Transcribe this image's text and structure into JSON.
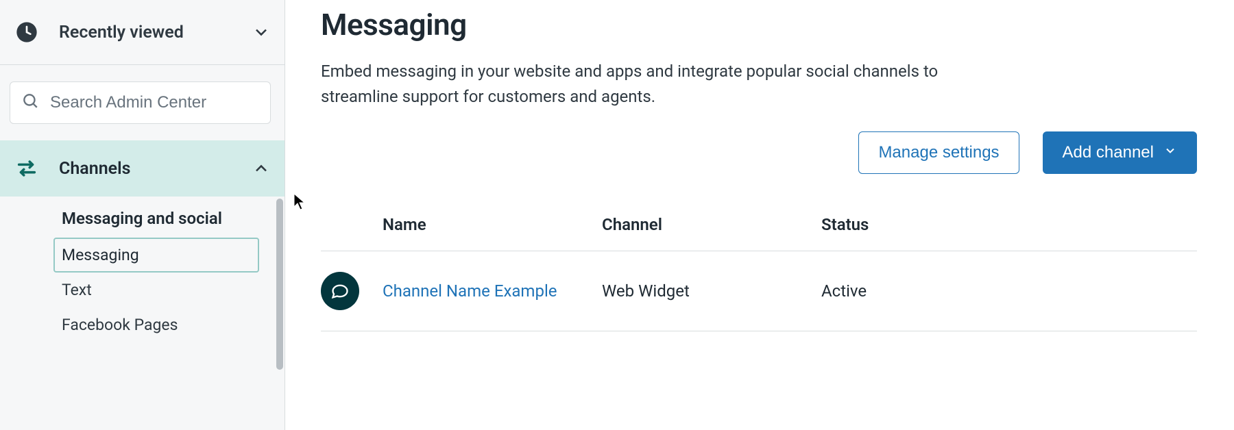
{
  "sidebar": {
    "recently_viewed": "Recently viewed",
    "search_placeholder": "Search Admin Center",
    "channels": "Channels",
    "group_title": "Messaging and social",
    "items": [
      {
        "label": "Messaging",
        "active": true
      },
      {
        "label": "Text",
        "active": false
      },
      {
        "label": "Facebook Pages",
        "active": false
      }
    ]
  },
  "page": {
    "title": "Messaging",
    "description": "Embed messaging in your website and apps and integrate popular social channels to streamline support for customers and agents."
  },
  "actions": {
    "manage": "Manage settings",
    "add_channel": "Add channel"
  },
  "table": {
    "headers": {
      "name": "Name",
      "channel": "Channel",
      "status": "Status"
    },
    "rows": [
      {
        "name": "Channel Name Example",
        "channel": "Web Widget",
        "status": "Active"
      }
    ]
  }
}
